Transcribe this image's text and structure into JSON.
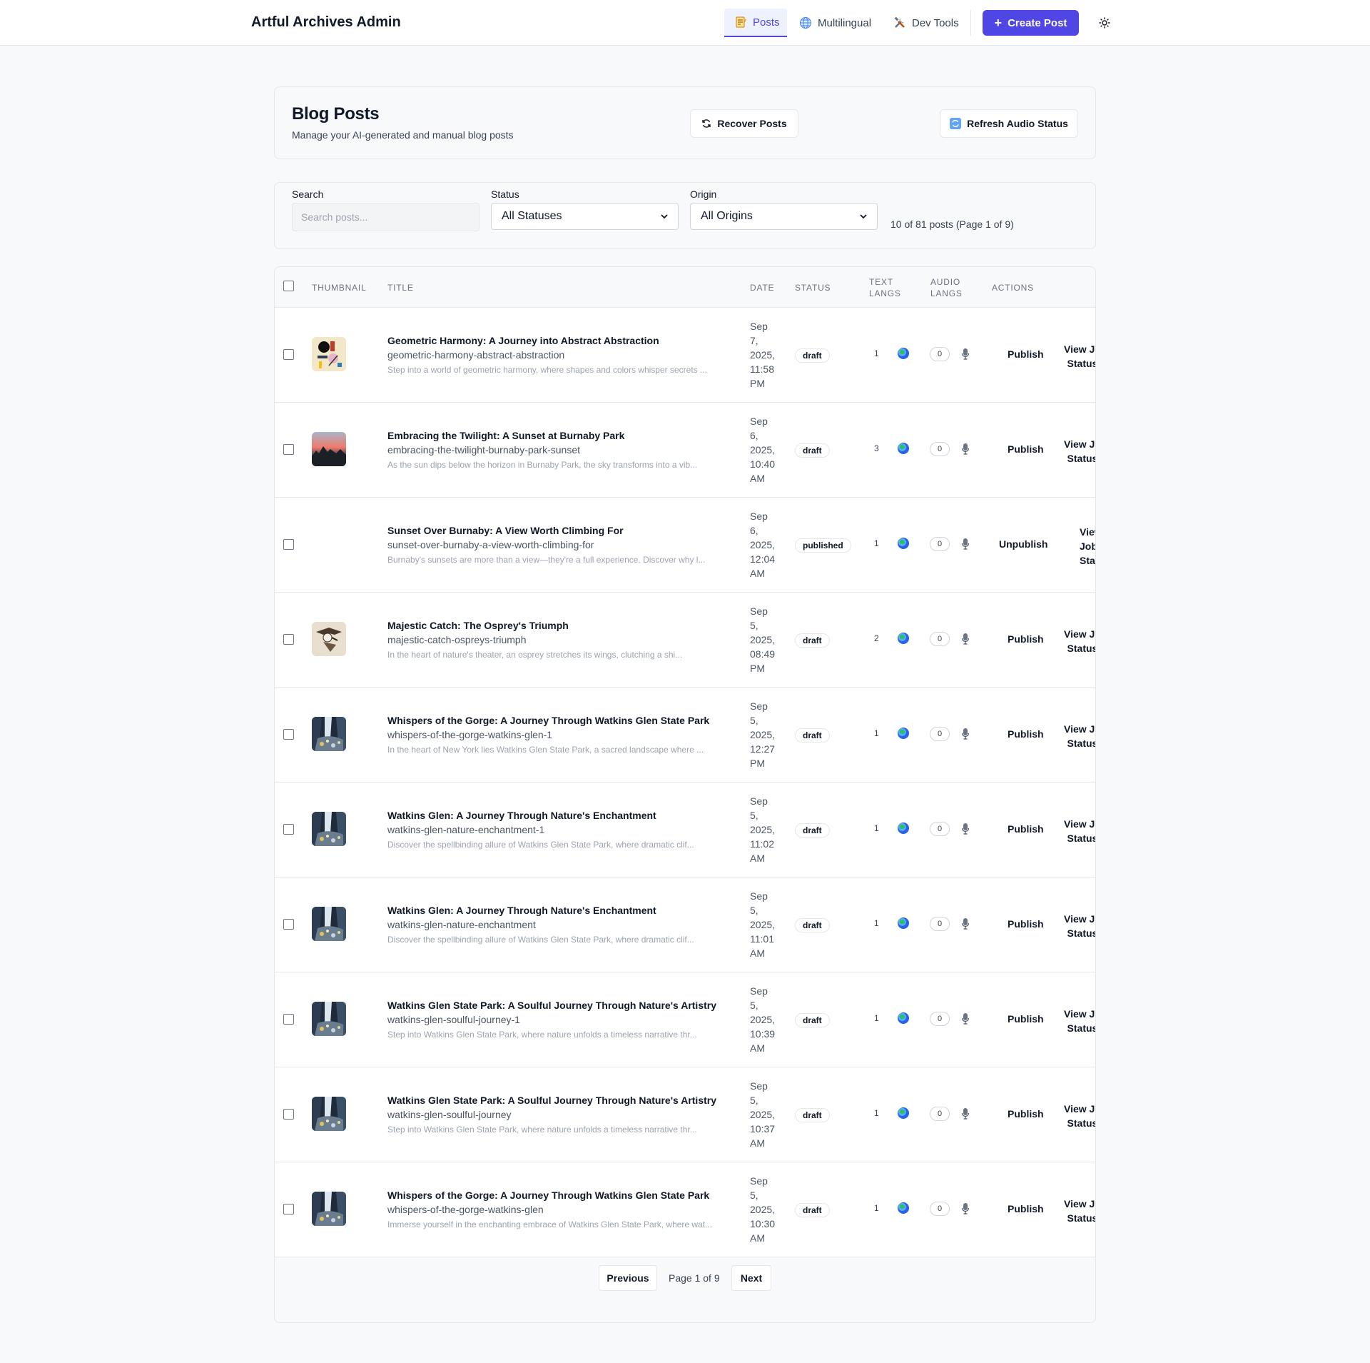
{
  "app": {
    "brand": "Artful Archives Admin",
    "nav": [
      {
        "label": "Posts",
        "icon": "memo-icon"
      },
      {
        "label": "Multilingual",
        "icon": "globe-icon"
      },
      {
        "label": "Dev Tools",
        "icon": "tools-icon"
      }
    ],
    "create_label": "Create Post",
    "accent": "#4f46e5"
  },
  "header": {
    "title": "Blog Posts",
    "subtitle": "Manage your AI-generated and manual blog posts",
    "recover_label": "Recover Posts",
    "refresh_label": "Refresh Audio Status"
  },
  "filters": {
    "search_label": "Search",
    "search_placeholder": "Search posts...",
    "status_label": "Status",
    "status_value": "All Statuses",
    "origin_label": "Origin",
    "origin_value": "All Origins",
    "count_text": "10 of 81 posts (Page 1 of 9)"
  },
  "table": {
    "headers": {
      "thumbnail": "THUMBNAIL",
      "title": "TITLE",
      "date": "DATE",
      "status": "STATUS",
      "text_langs": [
        "TEXT",
        "LANGS"
      ],
      "audio_langs": [
        "AUDIO",
        "LANGS"
      ],
      "actions": "ACTIONS"
    },
    "rows": [
      {
        "title": "Geometric Harmony: A Journey into Abstract Abstraction",
        "slug": "geometric-harmony-abstract-abstraction",
        "excerpt": "Step into a world of geometric harmony, where shapes and colors whisper secrets ...",
        "date": [
          "Sep",
          "7,",
          "2025,",
          "11:58",
          "PM"
        ],
        "status": "draft",
        "text_langs": "1",
        "audio_langs": "0",
        "action": "Publish",
        "view": [
          "View Jo",
          "Status"
        ],
        "thumb": "abstract"
      },
      {
        "title": "Embracing the Twilight: A Sunset at Burnaby Park",
        "slug": "embracing-the-twilight-burnaby-park-sunset",
        "excerpt": "As the sun dips below the horizon in Burnaby Park, the sky transforms into a vib...",
        "date": [
          "Sep",
          "6,",
          "2025,",
          "10:40",
          "AM"
        ],
        "status": "draft",
        "text_langs": "3",
        "audio_langs": "0",
        "action": "Publish",
        "view": [
          "View Jo",
          "Status"
        ],
        "thumb": "sunset"
      },
      {
        "title": "Sunset Over Burnaby: A View Worth Climbing For",
        "slug": "sunset-over-burnaby-a-view-worth-climbing-for",
        "excerpt": "Burnaby's sunsets are more than a view—they're a full experience. Discover why l...",
        "date": [
          "Sep",
          "6,",
          "2025,",
          "12:04",
          "AM"
        ],
        "status": "published",
        "text_langs": "1",
        "audio_langs": "0",
        "action": "Unpublish",
        "view": [
          "View",
          "Job",
          "Statu"
        ],
        "thumb": "none"
      },
      {
        "title": "Majestic Catch: The Osprey's Triumph",
        "slug": "majestic-catch-ospreys-triumph",
        "excerpt": "In the heart of nature's theater, an osprey stretches its wings, clutching a shi...",
        "date": [
          "Sep",
          "5,",
          "2025,",
          "08:49",
          "PM"
        ],
        "status": "draft",
        "text_langs": "2",
        "audio_langs": "0",
        "action": "Publish",
        "view": [
          "View Jo",
          "Status"
        ],
        "thumb": "osprey"
      },
      {
        "title": "Whispers of the Gorge: A Journey Through Watkins Glen State Park",
        "slug": "whispers-of-the-gorge-watkins-glen-1",
        "excerpt": "In the heart of New York lies Watkins Glen State Park, a sacred landscape where ...",
        "date": [
          "Sep",
          "5,",
          "2025,",
          "12:27",
          "PM"
        ],
        "status": "draft",
        "text_langs": "1",
        "audio_langs": "0",
        "action": "Publish",
        "view": [
          "View Jo",
          "Status"
        ],
        "thumb": "gorge"
      },
      {
        "title": "Watkins Glen: A Journey Through Nature's Enchantment",
        "slug": "watkins-glen-nature-enchantment-1",
        "excerpt": "Discover the spellbinding allure of Watkins Glen State Park, where dramatic clif...",
        "date": [
          "Sep",
          "5,",
          "2025,",
          "11:02",
          "AM"
        ],
        "status": "draft",
        "text_langs": "1",
        "audio_langs": "0",
        "action": "Publish",
        "view": [
          "View Jo",
          "Status"
        ],
        "thumb": "gorge"
      },
      {
        "title": "Watkins Glen: A Journey Through Nature's Enchantment",
        "slug": "watkins-glen-nature-enchantment",
        "excerpt": "Discover the spellbinding allure of Watkins Glen State Park, where dramatic clif...",
        "date": [
          "Sep",
          "5,",
          "2025,",
          "11:01",
          "AM"
        ],
        "status": "draft",
        "text_langs": "1",
        "audio_langs": "0",
        "action": "Publish",
        "view": [
          "View Jo",
          "Status"
        ],
        "thumb": "gorge"
      },
      {
        "title": "Watkins Glen State Park: A Soulful Journey Through Nature's Artistry",
        "slug": "watkins-glen-soulful-journey-1",
        "excerpt": "Step into Watkins Glen State Park, where nature unfolds a timeless narrative thr...",
        "date": [
          "Sep",
          "5,",
          "2025,",
          "10:39",
          "AM"
        ],
        "status": "draft",
        "text_langs": "1",
        "audio_langs": "0",
        "action": "Publish",
        "view": [
          "View Jo",
          "Status"
        ],
        "thumb": "gorge"
      },
      {
        "title": "Watkins Glen State Park: A Soulful Journey Through Nature's Artistry",
        "slug": "watkins-glen-soulful-journey",
        "excerpt": "Step into Watkins Glen State Park, where nature unfolds a timeless narrative thr...",
        "date": [
          "Sep",
          "5,",
          "2025,",
          "10:37",
          "AM"
        ],
        "status": "draft",
        "text_langs": "1",
        "audio_langs": "0",
        "action": "Publish",
        "view": [
          "View Jo",
          "Status"
        ],
        "thumb": "gorge"
      },
      {
        "title": "Whispers of the Gorge: A Journey Through Watkins Glen State Park",
        "slug": "whispers-of-the-gorge-watkins-glen",
        "excerpt": "Immerse yourself in the enchanting embrace of Watkins Glen State Park, where wat...",
        "date": [
          "Sep",
          "5,",
          "2025,",
          "10:30",
          "AM"
        ],
        "status": "draft",
        "text_langs": "1",
        "audio_langs": "0",
        "action": "Publish",
        "view": [
          "View Jo",
          "Status"
        ],
        "thumb": "gorge"
      }
    ]
  },
  "pagination": {
    "prev_label": "Previous",
    "page_text": "Page 1 of 9",
    "next_label": "Next"
  }
}
